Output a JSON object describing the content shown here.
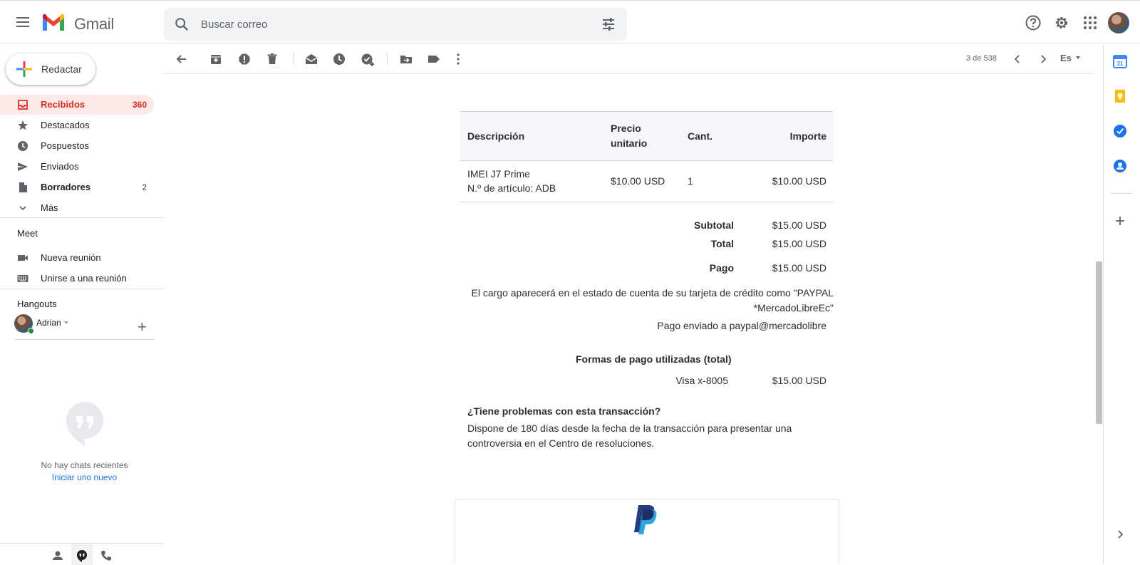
{
  "app": {
    "name": "Gmail"
  },
  "search": {
    "placeholder": "Buscar correo"
  },
  "compose": {
    "label": "Redactar"
  },
  "nav": {
    "items": [
      {
        "label": "Recibidos",
        "count": "360"
      },
      {
        "label": "Destacados",
        "count": ""
      },
      {
        "label": "Pospuestos",
        "count": ""
      },
      {
        "label": "Enviados",
        "count": ""
      },
      {
        "label": "Borradores",
        "count": "2"
      },
      {
        "label": "Más",
        "count": ""
      }
    ]
  },
  "meet": {
    "title": "Meet",
    "items": [
      {
        "label": "Nueva reunión"
      },
      {
        "label": "Unirse a una reunión"
      }
    ]
  },
  "hangouts": {
    "title": "Hangouts",
    "user": "Adrian",
    "no_chats": "No hay chats recientes",
    "start_new": "Iniciar uno nuevo"
  },
  "toolbar": {
    "pager": "3 de 538",
    "lang": "Es"
  },
  "email": {
    "table": {
      "headers": {
        "desc": "Descripción",
        "price_l1": "Precio",
        "price_l2": "unitario",
        "qty": "Cant.",
        "amount": "Importe"
      },
      "row": {
        "desc_l1": "IMEI J7 Prime",
        "desc_l2": "N.º de artículo: ADB",
        "price": "$10.00 USD",
        "qty": "1",
        "amount": "$10.00 USD"
      }
    },
    "summary": {
      "subtotal_label": "Subtotal",
      "subtotal": "$15.00 USD",
      "total_label": "Total",
      "total": "$15.00 USD",
      "payment_label": "Pago",
      "payment": "$15.00 USD"
    },
    "charge_notice_l1": "El cargo aparecerá en el estado de cuenta de su tarjeta de crédito como \"PAYPAL",
    "charge_notice_l2": "*MercadoLibreEc\"",
    "sent_to": "Pago enviado a paypal@mercadolibre",
    "funding_title": "Formas de pago utilizadas (total)",
    "funding_method": "Visa x-8005",
    "funding_amount": "$15.00 USD",
    "problem_title": "¿Tiene problemas con esta transacción?",
    "problem_text_l1": "Dispone de 180 días desde la fecha de la transacción para presentar una",
    "problem_text_l2": "controversia en el Centro de resoluciones."
  },
  "colors": {
    "accent_red": "#d93025",
    "active_bg": "#fce8e6",
    "link_blue": "#1a73e8",
    "paypal_dark": "#253b80",
    "paypal_light": "#179bd7"
  },
  "icons": {
    "header": [
      "menu-icon",
      "gmail-logo-icon",
      "search-icon",
      "tune-icon",
      "help-icon",
      "settings-icon",
      "apps-icon",
      "account-avatar"
    ],
    "toolbar": [
      "back-arrow-icon",
      "archive-icon",
      "report-spam-icon",
      "delete-icon",
      "mark-unread-icon",
      "snooze-icon",
      "add-task-icon",
      "move-to-icon",
      "label-icon",
      "more-icon",
      "prev-icon",
      "next-icon"
    ],
    "right_panel": [
      "calendar-icon",
      "keep-icon",
      "tasks-icon",
      "contacts-icon",
      "add-addon-icon",
      "expand-panel-icon"
    ]
  }
}
